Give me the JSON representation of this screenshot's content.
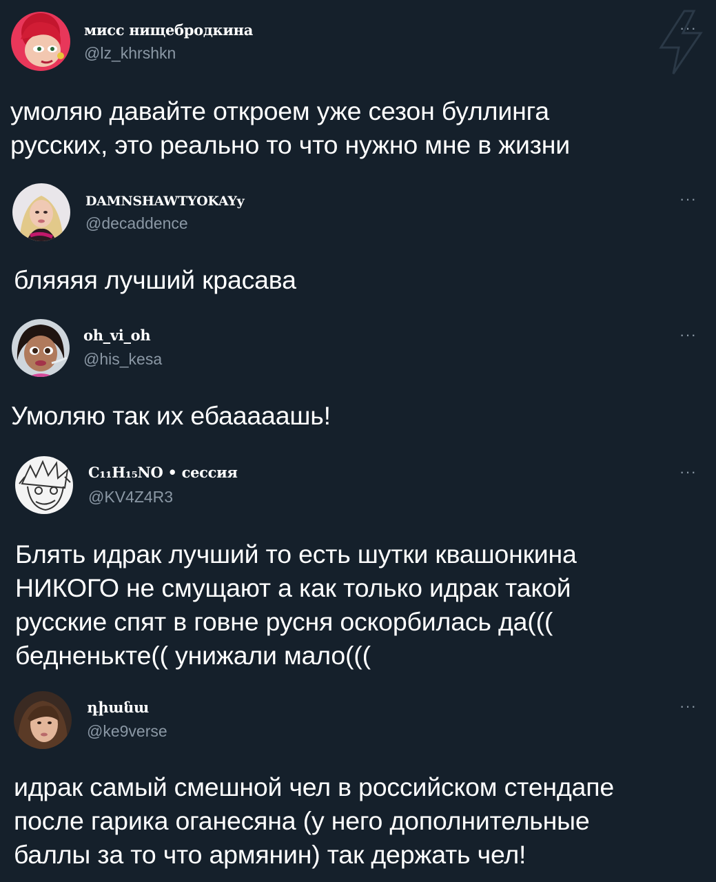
{
  "tweets": [
    {
      "display_name": "мисс нищебродкина",
      "handle": "@lz_khrshkn",
      "text": "умоляю давайте откроем уже сезон буллинга\nрусских, это реально то что нужно мне в жизни",
      "more_icon": "more-horizontal-icon"
    },
    {
      "display_name": "DAMNSHAWTYOKAYy",
      "handle": "@decaddence",
      "text": "бляяяя лучший красава",
      "more_icon": "more-horizontal-icon"
    },
    {
      "display_name": "oh_vi_oh",
      "handle": "@his_kesa",
      "text": "Умоляю так их ебааааашь!",
      "more_icon": "more-horizontal-icon"
    },
    {
      "display_name": "C₁₁H₁₅NO • сессия",
      "handle": "@KV4Z4R3",
      "text": "Блять идрак лучший то есть шутки квашонкина\nНИКОГО не смущают а как только идрак такой\nрусские спят в говне русня оскорбилась да(((\nбедненькте(( унижали мало(((",
      "more_icon": "more-horizontal-icon"
    },
    {
      "display_name": "դիանա",
      "handle": "@ke9verse",
      "text": "идрак самый смешной чел в российском стендапе\nпосле гарика оганесяна (у него дополнительные\nбаллы за то что армянин) так держать чел!",
      "more_icon": "more-horizontal-icon"
    }
  ],
  "more_glyph": "···",
  "watermark_icon": "lightning-bolt-icon",
  "colors": {
    "background": "#15202b",
    "text": "#ffffff",
    "secondary": "#8b98a5"
  }
}
